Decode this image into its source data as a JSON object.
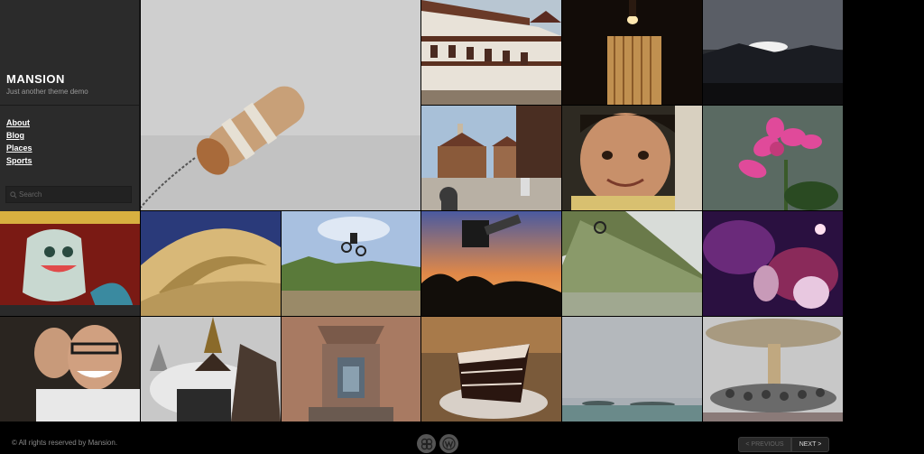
{
  "site": {
    "title": "MANSION",
    "tagline": "Just another theme demo"
  },
  "nav": {
    "items": [
      {
        "label": "About"
      },
      {
        "label": "Blog"
      },
      {
        "label": "Places"
      },
      {
        "label": "Sports"
      }
    ]
  },
  "search": {
    "placeholder": "Search"
  },
  "footer": {
    "copyright": "© All rights reserved by Mansion."
  },
  "badges": [
    {
      "icon": "theme-logo-icon"
    },
    {
      "icon": "wordpress-icon"
    }
  ],
  "pager": {
    "prev_label": "< PREVIOUS",
    "next_label": "NEXT >"
  },
  "gallery": [
    {
      "name": "photo-buoy-fog"
    },
    {
      "name": "photo-palace"
    },
    {
      "name": "photo-candle-lamp"
    },
    {
      "name": "photo-mountain-sunset"
    },
    {
      "name": "photo-temple-square"
    },
    {
      "name": "photo-child-smile"
    },
    {
      "name": "photo-pink-flower"
    },
    {
      "name": "photo-lion-statue"
    },
    {
      "name": "photo-sculpture-curve"
    },
    {
      "name": "photo-bmx-jump"
    },
    {
      "name": "photo-skateboard-sunset"
    },
    {
      "name": "photo-bike-ramp"
    },
    {
      "name": "photo-concert-lights"
    },
    {
      "name": "photo-couple-selfie"
    },
    {
      "name": "photo-stupa"
    },
    {
      "name": "photo-shrine-window"
    },
    {
      "name": "photo-chocolate-cake"
    },
    {
      "name": "photo-lake-island"
    },
    {
      "name": "photo-carousel"
    }
  ]
}
